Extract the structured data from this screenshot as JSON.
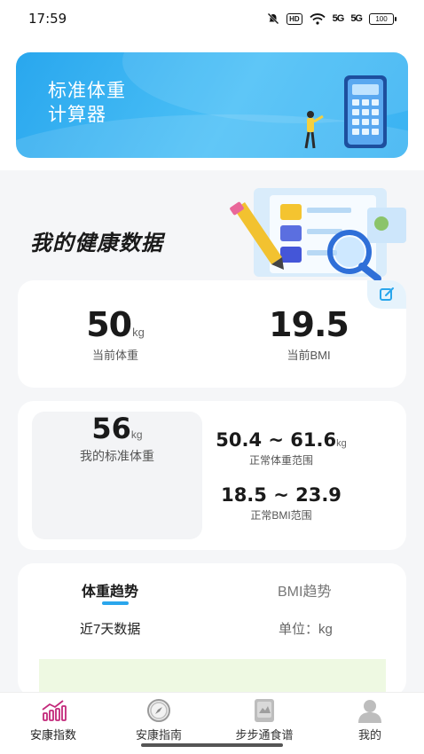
{
  "status_bar": {
    "time": "17:59",
    "hd": "HD",
    "signal1": "5G",
    "signal2": "5G",
    "battery": "100"
  },
  "banner": {
    "title": "标准体重\n计算器"
  },
  "health": {
    "title": "我的健康数据"
  },
  "summary": {
    "weight_value": "50",
    "weight_unit": "kg",
    "weight_label": "当前体重",
    "bmi_value": "19.5",
    "bmi_label": "当前BMI"
  },
  "standard": {
    "std_weight_value": "56",
    "std_weight_unit": "kg",
    "std_weight_label": "我的标准体重",
    "normal_weight_range": "50.4 ~ 61.6",
    "normal_weight_unit": "kg",
    "normal_weight_label": "正常体重范围",
    "normal_bmi_range": "18.5 ~ 23.9",
    "normal_bmi_label": "正常BMI范围"
  },
  "trend": {
    "tabs": [
      "体重趋势",
      "BMI趋势"
    ],
    "period": "近7天数据",
    "unit": "单位：kg"
  },
  "bottom_nav": {
    "items": [
      {
        "label": "安康指数",
        "icon": "chart-bars-icon"
      },
      {
        "label": "安康指南",
        "icon": "compass-icon"
      },
      {
        "label": "步步通食谱",
        "icon": "recipe-book-icon"
      },
      {
        "label": "我的",
        "icon": "user-icon"
      }
    ]
  },
  "colors": {
    "accent": "#2aa6ec",
    "active_nav": "#c3287a",
    "banner": "#3ab2f2"
  }
}
